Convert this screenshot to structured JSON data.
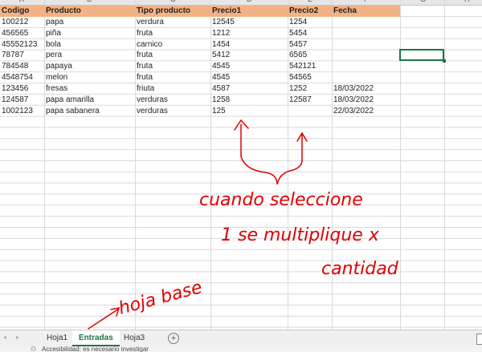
{
  "columns": [
    "A",
    "B",
    "C",
    "D",
    "E",
    "F",
    "G",
    "H"
  ],
  "headers": [
    "Codigo",
    "Producto",
    "Tipo producto",
    "Precio1",
    "Precio2",
    "Fecha"
  ],
  "rows": [
    [
      "100212",
      "papa",
      "verdura",
      "12545",
      "1254",
      ""
    ],
    [
      "456565",
      "piña",
      "fruta",
      "1212",
      "5454",
      ""
    ],
    [
      "45552123",
      "bola",
      "carnico",
      "1454",
      "5457",
      ""
    ],
    [
      "78787",
      "pera",
      "fruta",
      "5412",
      "6565",
      ""
    ],
    [
      "784548",
      "papaya",
      "fruta",
      "4545",
      "542121",
      ""
    ],
    [
      "4548754",
      "melon",
      "fruta",
      "4545",
      "54565",
      ""
    ],
    [
      "123456",
      "fresas",
      "friuta",
      "4587",
      "1252",
      "18/03/2022"
    ],
    [
      "124587",
      "papa amarilla",
      "verduras",
      "1258",
      "12587",
      "18/03/2022"
    ],
    [
      "1002123",
      "papa sabanera",
      "verduras",
      "125",
      "",
      "22/03/2022"
    ]
  ],
  "sheet_tabs": [
    "Hoja1",
    "Entradas",
    "Hoja3"
  ],
  "active_tab": "Entradas",
  "status_text": "Accesibilidad: es necesario investigar",
  "annotations": {
    "line1": "cuando seleccione",
    "line2": "1 se multiplique x",
    "line3": "cantidad",
    "note": "hoja base"
  },
  "colors": {
    "header_fill": "#f4b183",
    "accent": "#217346",
    "ink": "#e00000"
  }
}
